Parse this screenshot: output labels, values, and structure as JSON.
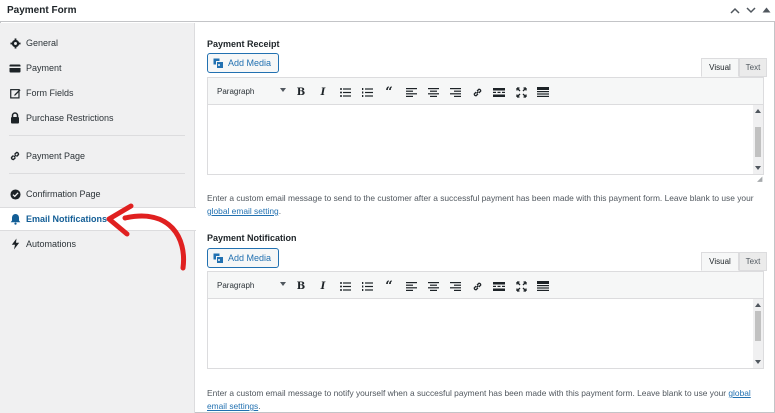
{
  "header": {
    "title": "Payment Form"
  },
  "sidebar": {
    "items": [
      {
        "label": "General",
        "icon": "gear-icon"
      },
      {
        "label": "Payment",
        "icon": "card-icon"
      },
      {
        "label": "Form Fields",
        "icon": "edit-icon"
      },
      {
        "label": "Purchase Restrictions",
        "icon": "lock-icon"
      },
      {
        "label": "Payment Page",
        "icon": "link-icon"
      },
      {
        "label": "Confirmation Page",
        "icon": "check-circle-icon"
      },
      {
        "label": "Email Notifications",
        "icon": "bell-icon",
        "active": true
      },
      {
        "label": "Automations",
        "icon": "bolt-icon"
      }
    ]
  },
  "receipt": {
    "label": "Payment Receipt",
    "add_media": "Add Media",
    "tab_visual": "Visual",
    "tab_text": "Text",
    "format": "Paragraph",
    "help_before": "Enter a custom email message to send to the customer after a successful payment has been made with this payment form. Leave blank to use your ",
    "help_link": "global email setting",
    "help_after": "."
  },
  "notification": {
    "label": "Payment Notification",
    "add_media": "Add Media",
    "tab_visual": "Visual",
    "tab_text": "Text",
    "format": "Paragraph",
    "help_before": "Enter a custom email message to notify yourself when a succesful payment has been made with this payment form. Leave blank to use your ",
    "help_link": "global email settings",
    "help_after": "."
  },
  "colors": {
    "accent": "#2271b1",
    "active_text": "#135e96",
    "arrow": "#e02020"
  }
}
